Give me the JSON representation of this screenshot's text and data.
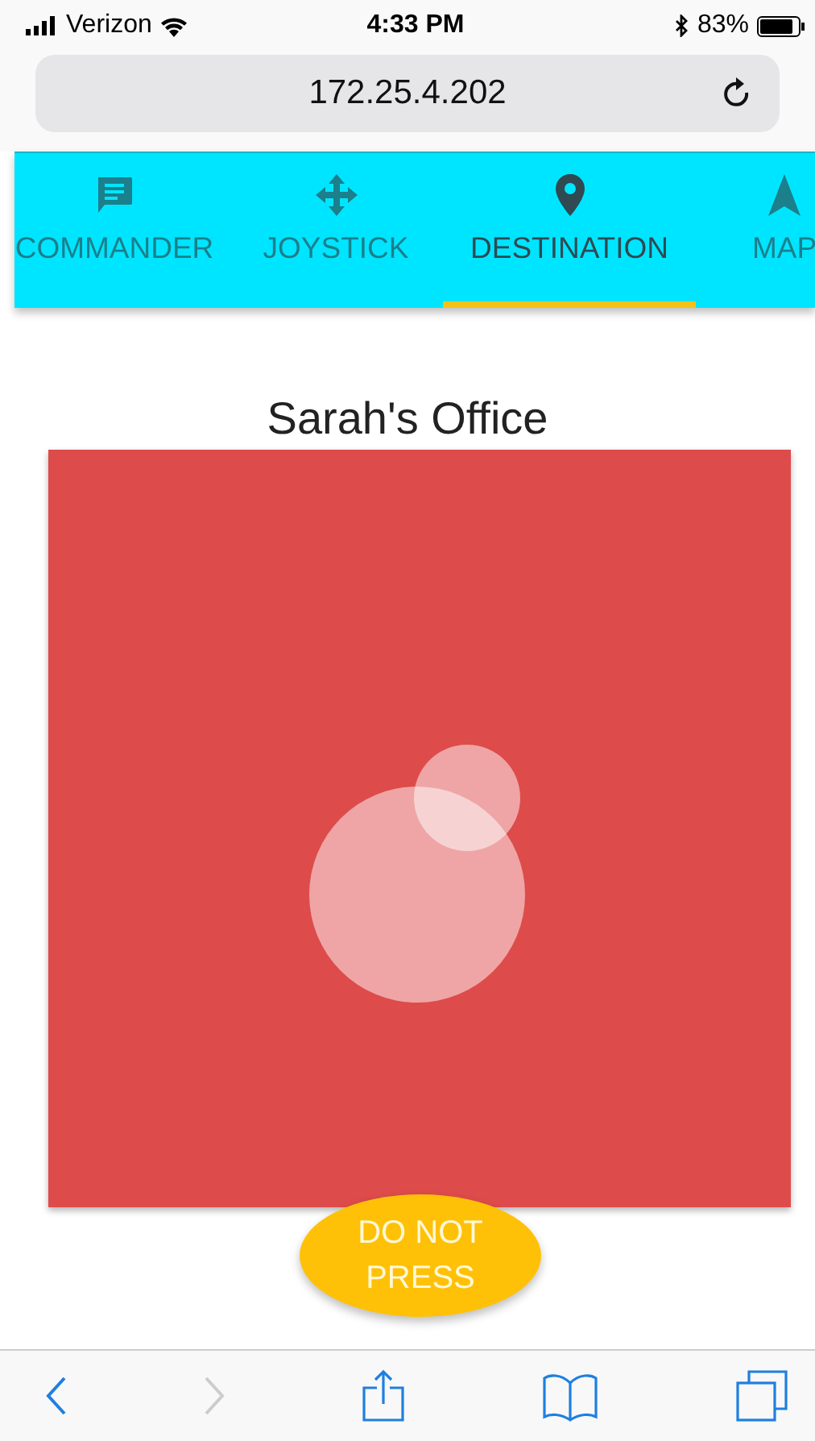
{
  "status_bar": {
    "carrier": "Verizon",
    "time": "4:33 PM",
    "battery": "83%"
  },
  "address_bar": {
    "url": "172.25.4.202"
  },
  "tabs": [
    {
      "label": "COMMANDER",
      "kind": "chat",
      "selected": false
    },
    {
      "label": "JOYSTICK",
      "kind": "move",
      "selected": false
    },
    {
      "label": "DESTINATION",
      "kind": "pin",
      "selected": true
    },
    {
      "label": "MAP",
      "kind": "navigate",
      "selected": false
    }
  ],
  "destination": {
    "title": "Sarah's Office"
  },
  "button": {
    "label": "DO NOT\nPRESS"
  },
  "toolbar": [
    {
      "kind": "back",
      "disabled": false
    },
    {
      "kind": "forward",
      "disabled": true
    },
    {
      "kind": "share",
      "disabled": false
    },
    {
      "kind": "bookmarks",
      "disabled": false
    },
    {
      "kind": "tabs",
      "disabled": false
    }
  ]
}
